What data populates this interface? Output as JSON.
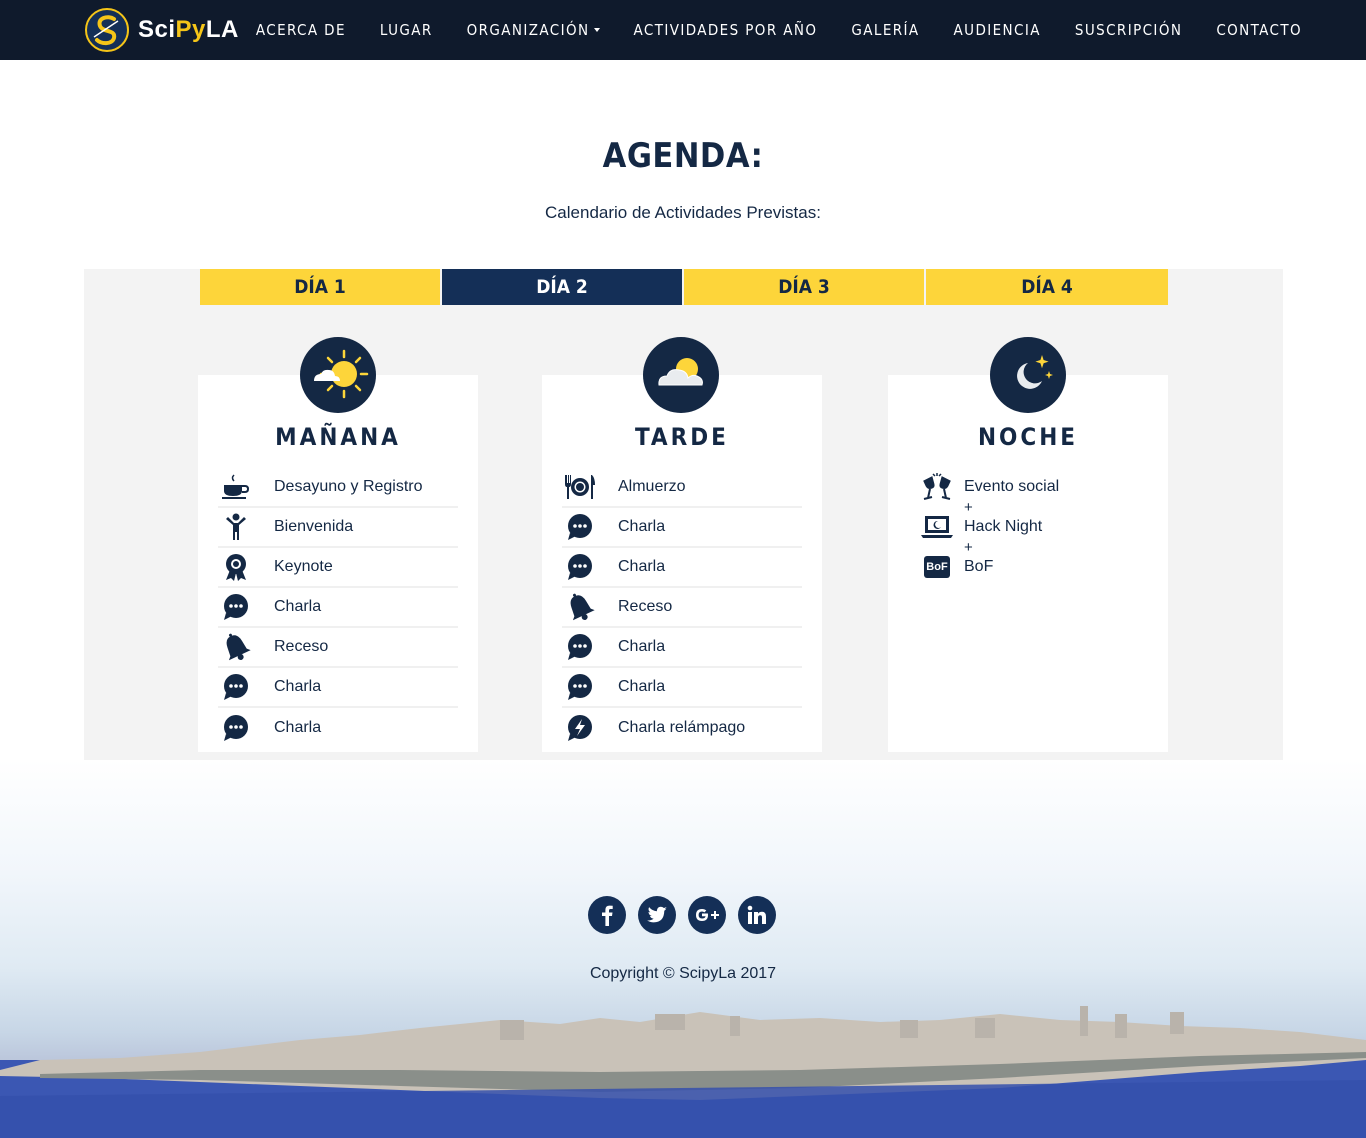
{
  "header": {
    "brand": {
      "name_part1": "Sci",
      "name_part2": "Py",
      "name_part3": "LA"
    },
    "nav": [
      {
        "label": "ACERCA DE"
      },
      {
        "label": "LUGAR"
      },
      {
        "label": "ORGANIZACIÓN",
        "has_dropdown": true
      },
      {
        "label": "ACTIVIDADES POR AÑO"
      },
      {
        "label": "GALERÍA"
      },
      {
        "label": "AUDIENCIA"
      },
      {
        "label": "SUSCRIPCIÓN"
      },
      {
        "label": "CONTACTO"
      }
    ]
  },
  "main": {
    "title": "AGENDA:",
    "subtitle": "Calendario de Actividades Previstas:",
    "tabs": [
      {
        "label": "DÍA 1",
        "active": false
      },
      {
        "label": "DÍA 2",
        "active": true
      },
      {
        "label": "DÍA 3",
        "active": false
      },
      {
        "label": "DÍA 4",
        "active": false
      }
    ],
    "sessions": {
      "morning": {
        "title": "MAÑANA",
        "icon": "sun-cloud-icon",
        "items": [
          {
            "label": "Desayuno y Registro",
            "icon": "coffee-icon"
          },
          {
            "label": "Bienvenida",
            "icon": "person-icon"
          },
          {
            "label": "Keynote",
            "icon": "medal-icon"
          },
          {
            "label": "Charla",
            "icon": "chat-icon"
          },
          {
            "label": "Receso",
            "icon": "bell-icon"
          },
          {
            "label": "Charla",
            "icon": "chat-icon"
          },
          {
            "label": "Charla",
            "icon": "chat-icon"
          }
        ]
      },
      "afternoon": {
        "title": "TARDE",
        "icon": "cloud-sun-icon",
        "items": [
          {
            "label": "Almuerzo",
            "icon": "cutlery-icon"
          },
          {
            "label": "Charla",
            "icon": "chat-icon"
          },
          {
            "label": "Charla",
            "icon": "chat-icon"
          },
          {
            "label": "Receso",
            "icon": "bell-icon"
          },
          {
            "label": "Charla",
            "icon": "chat-icon"
          },
          {
            "label": "Charla",
            "icon": "chat-icon"
          },
          {
            "label": "Charla relámpago",
            "icon": "lightning-icon"
          }
        ]
      },
      "night": {
        "title": "NOCHE",
        "icon": "moon-stars-icon",
        "items": [
          {
            "label": "Evento social",
            "icon": "cheers-icon"
          },
          {
            "label": "Hack Night",
            "icon": "laptop-icon"
          },
          {
            "label": "BoF",
            "icon": "bof-icon",
            "icon_text": "BoF"
          }
        ],
        "separator": "+"
      }
    }
  },
  "footer": {
    "social": [
      {
        "name": "facebook-icon",
        "glyph": "f"
      },
      {
        "name": "twitter-icon",
        "glyph": "t"
      },
      {
        "name": "google-plus-icon",
        "glyph": "g+"
      },
      {
        "name": "linkedin-icon",
        "glyph": "in"
      }
    ],
    "copyright": "Copyright © ScipyLa 2017"
  },
  "colors": {
    "navy": "#142844",
    "nav_bg": "#0f1a2c",
    "active_tab": "#142f57",
    "yellow": "#fdd53a",
    "panel_bg": "#f3f3f3"
  }
}
